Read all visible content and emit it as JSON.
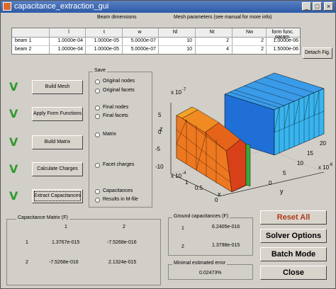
{
  "window": {
    "title": "capacitance_extraction_gui"
  },
  "table": {
    "group_beam": "Beam dimensions",
    "group_mesh": "Mesh parameters (see manual for more info)",
    "headers": [
      "l",
      "t",
      "w",
      "Nl",
      "Nt",
      "Nw",
      "form func. param."
    ],
    "rows": [
      {
        "label": "beam 1",
        "values": [
          "1.0000e-04",
          "1.0000e-05",
          "5.0000e-07",
          "10",
          "2",
          "2",
          "1.0000e-06"
        ]
      },
      {
        "label": "beam 2",
        "values": [
          "1.0000e-04",
          "1.0000e-05",
          "5.0000e-07",
          "10",
          "4",
          "2",
          "1.5000e-06"
        ]
      }
    ]
  },
  "detach_label": "Detach Fig.",
  "steps": [
    {
      "check": "V",
      "label": "Build Mesh"
    },
    {
      "check": "V",
      "label": "Apply Form Functions"
    },
    {
      "check": "V",
      "label": "Build Matrix"
    },
    {
      "check": "V",
      "label": "Calculate Charges"
    },
    {
      "check": "V",
      "label": "Extract Capacitances"
    }
  ],
  "save": {
    "title": "Save",
    "options": [
      "Original nodes",
      "Original facets",
      "Final nodes",
      "Final facets",
      "Matrix",
      "Facet charges",
      "Capacitances",
      "Results in M-file"
    ]
  },
  "plot": {
    "z_exp": "x 10",
    "z_exp_pow": "-7",
    "z_label": "z",
    "z_ticks": [
      "5",
      "0",
      "-5",
      "-10"
    ],
    "x_exp": "x 10",
    "x_exp_pow": "-4",
    "x_label": "x",
    "x_ticks": [
      "1",
      "0.5",
      "0"
    ],
    "y_exp": "x 10",
    "y_exp_pow": "-6",
    "y_label": "y",
    "y_ticks": [
      "20",
      "15",
      "10",
      "5",
      "0"
    ]
  },
  "cap_matrix": {
    "title": "Capacitance Matrix (F)",
    "col_headers": [
      "1",
      "2"
    ],
    "row_headers": [
      "1",
      "2"
    ],
    "values": [
      [
        "1.3767e-015",
        "-7.5268e-016"
      ],
      [
        "-7.5268e-016",
        "2.1324e-015"
      ]
    ]
  },
  "ground": {
    "title": "Ground capacitances (F)",
    "rows": [
      {
        "label": "1",
        "value": "6.2405e-016"
      },
      {
        "label": "2",
        "value": "1.3798e-015"
      }
    ]
  },
  "error": {
    "title": "Minimal estimated error",
    "value": "0.02473%"
  },
  "buttons": {
    "reset": "Reset All",
    "solver": "Solver Options",
    "batch": "Batch Mode",
    "close": "Close"
  },
  "colors": {
    "reset": "#b03a1a",
    "check": "#2f9a2f",
    "title_bar": "#2c5aa8"
  }
}
